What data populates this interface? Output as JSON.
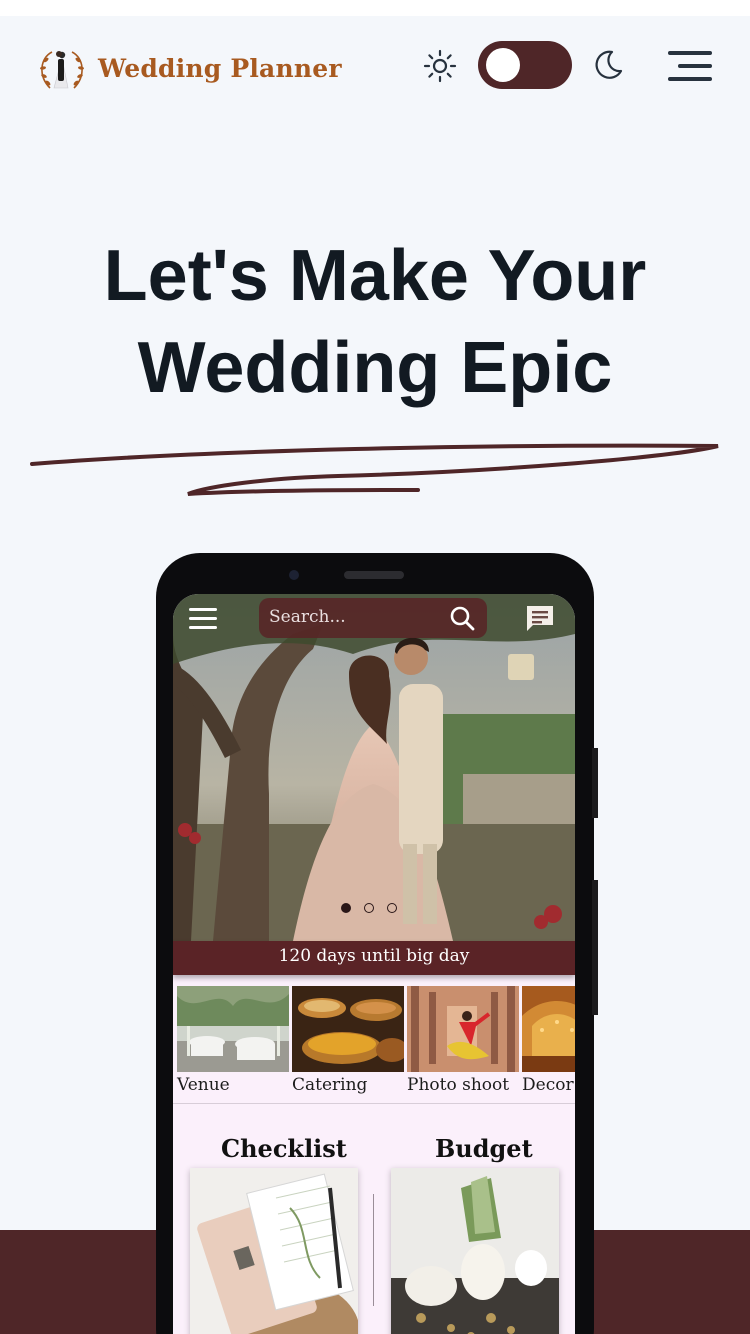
{
  "header": {
    "brand": "Wedding Planner",
    "theme_toggle": {
      "mode": "light",
      "icons": [
        "sun-icon",
        "moon-icon"
      ]
    },
    "menu_icon": "hamburger-icon"
  },
  "hero": {
    "title_line1": "Let's Make Your",
    "title_line2": "Wedding Epic"
  },
  "app": {
    "search_placeholder": "Search...",
    "carousel": {
      "slides": 3,
      "active": 1
    },
    "countdown": "120 days until big day",
    "categories": [
      {
        "label": "Venue"
      },
      {
        "label": "Catering"
      },
      {
        "label": "Photo shoot"
      },
      {
        "label": "Decor"
      }
    ],
    "sections": [
      {
        "title": "Checklist"
      },
      {
        "title": "Budget"
      }
    ]
  },
  "colors": {
    "brand": "#4f2628",
    "logo_text": "#a85a20",
    "background": "#f4f7fb",
    "app_surface": "#fbf0fb",
    "heading": "#121a22"
  }
}
